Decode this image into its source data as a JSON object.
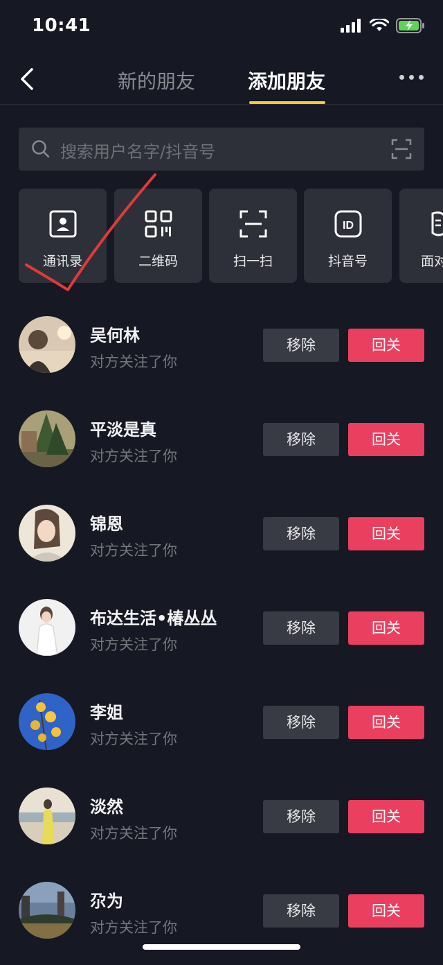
{
  "status_bar": {
    "time": "10:41"
  },
  "nav": {
    "tabs": [
      {
        "label": "新的朋友"
      },
      {
        "label": "添加朋友"
      }
    ]
  },
  "search": {
    "placeholder": "搜索用户名字/抖音号"
  },
  "quick_actions": [
    {
      "label": "通讯录",
      "icon": "contact-card-icon"
    },
    {
      "label": "二维码",
      "icon": "qr-code-icon"
    },
    {
      "label": "扫一扫",
      "icon": "scan-icon"
    },
    {
      "label": "抖音号",
      "icon": "id-badge-icon"
    },
    {
      "label": "面对",
      "icon": "face-to-face-icon"
    }
  ],
  "buttons": {
    "remove": "移除",
    "follow_back": "回关"
  },
  "users": [
    {
      "name": "吴何林",
      "status": "对方关注了你"
    },
    {
      "name": "平淡是真",
      "status": "对方关注了你"
    },
    {
      "name": "锦恩",
      "status": "对方关注了你"
    },
    {
      "name": "布达生活•椿丛丛",
      "status": "对方关注了你"
    },
    {
      "name": "李姐",
      "status": "对方关注了你"
    },
    {
      "name": "淡然",
      "status": "对方关注了你"
    },
    {
      "name": "尕为",
      "status": "对方关注了你"
    }
  ],
  "colors": {
    "background": "#161823",
    "accent_yellow": "#facb2d",
    "follow_red": "#ea3f5f",
    "annotation_red": "#e03a3a"
  }
}
